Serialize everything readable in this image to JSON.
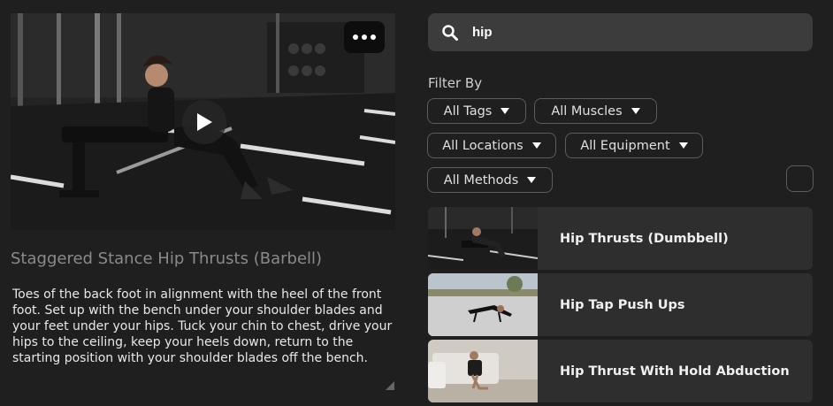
{
  "video": {
    "more_icon": "ellipsis-icon",
    "play_icon": "play-icon"
  },
  "exercise": {
    "title": "Staggered Stance Hip Thrusts (Barbell)",
    "description": "Toes of the back foot in alignment with the heel of the front foot. Set up with the bench under your shoulder blades and your feet under your hips. Tuck your chin to chest, drive your hips to the ceiling, keep your heels down, return to the starting position with your shoulder blades off the bench."
  },
  "search": {
    "value": "hip",
    "icon": "search-icon"
  },
  "filters": {
    "label": "Filter By",
    "tags": "All Tags",
    "muscles": "All Muscles",
    "locations": "All Locations",
    "equipment": "All Equipment",
    "methods": "All Methods"
  },
  "results": [
    {
      "title": "Hip Thrusts (Dumbbell)"
    },
    {
      "title": "Hip Tap Push Ups"
    },
    {
      "title": "Hip Thrust With Hold Abduction"
    }
  ],
  "colors": {
    "background": "#1f1f1f",
    "search_bg": "#3c3c3c",
    "card_bg": "#2e2e2e",
    "pill_border": "#5c5c5c"
  }
}
